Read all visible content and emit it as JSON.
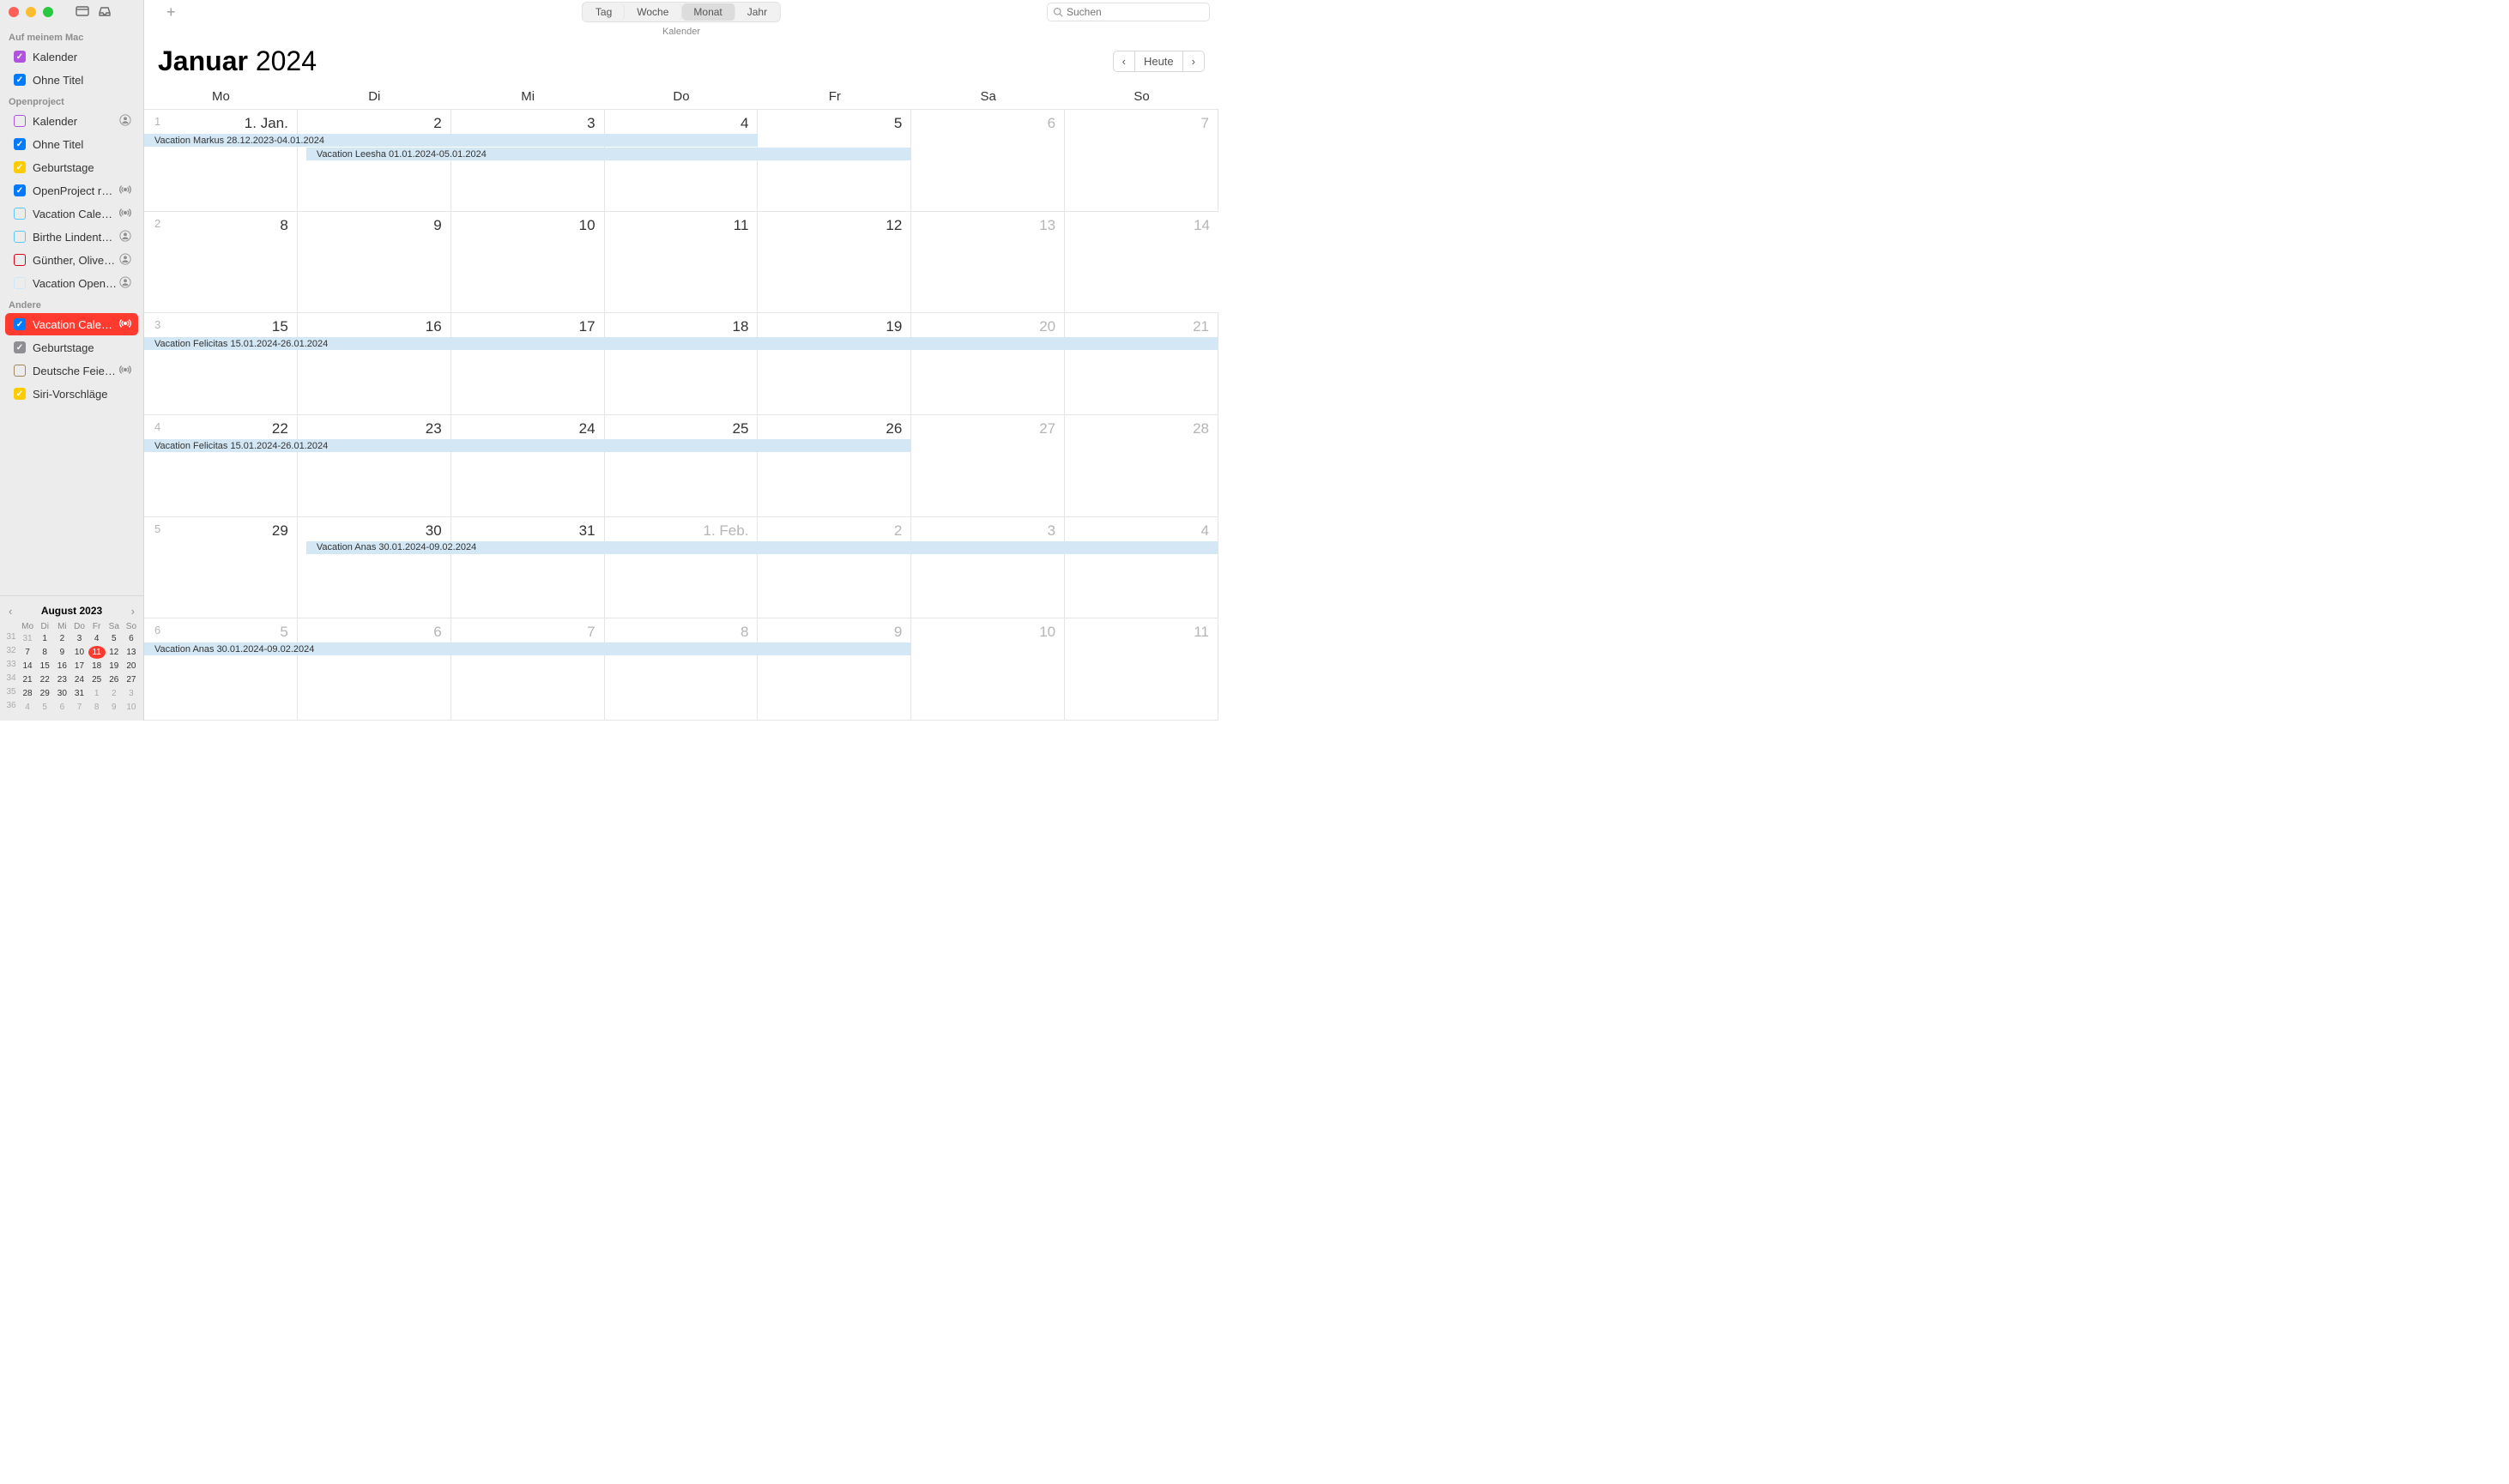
{
  "app_title": "Kalender",
  "views": {
    "day": "Tag",
    "week": "Woche",
    "month": "Monat",
    "year": "Jahr",
    "active": "month"
  },
  "search_placeholder": "Suchen",
  "today_button": "Heute",
  "month_title_month": "Januar",
  "month_title_year": "2024",
  "weekdays": [
    "Mo",
    "Di",
    "Mi",
    "Do",
    "Fr",
    "Sa",
    "So"
  ],
  "sidebar": {
    "sections": [
      {
        "title": "Auf meinem Mac",
        "items": [
          {
            "label": "Kalender",
            "color": "#af52de",
            "checked": true,
            "badge": null
          },
          {
            "label": "Ohne Titel",
            "color": "#007aff",
            "checked": true,
            "badge": null
          }
        ]
      },
      {
        "title": "Openproject",
        "items": [
          {
            "label": "Kalender",
            "color": "#af52de",
            "checked": false,
            "badge": "person"
          },
          {
            "label": "Ohne Titel",
            "color": "#007aff",
            "checked": true,
            "badge": null
          },
          {
            "label": "Geburtstage",
            "color": "#ffcc00",
            "checked": true,
            "badge": null
          },
          {
            "label": "OpenProject r…",
            "color": "#007aff",
            "checked": true,
            "badge": "broadcast"
          },
          {
            "label": "Vacation Cale…",
            "color": "#5ac8fa",
            "checked": false,
            "badge": "broadcast"
          },
          {
            "label": "Birthe Lindent…",
            "color": "#5ac8fa",
            "checked": false,
            "badge": "person",
            "faded": true
          },
          {
            "label": "Günther, Olive…",
            "color": "#d70015",
            "checked": false,
            "badge": "person",
            "solid": true
          },
          {
            "label": "Vacation Open…",
            "color": "#cce8f6",
            "checked": false,
            "badge": "person"
          }
        ]
      },
      {
        "title": "Andere",
        "items": [
          {
            "label": "Vacation Cale…",
            "color": "#007aff",
            "checked": true,
            "badge": "broadcast",
            "selected": true
          },
          {
            "label": "Geburtstage",
            "color": "#8e8e93",
            "checked": true,
            "badge": null
          },
          {
            "label": "Deutsche Feie…",
            "color": "#a2845e",
            "checked": false,
            "badge": "broadcast",
            "solid": true
          },
          {
            "label": "Siri-Vorschläge",
            "color": "#ffcc00",
            "checked": true,
            "badge": null
          }
        ]
      }
    ]
  },
  "mini_cal": {
    "title": "August 2023",
    "dow": [
      "Mo",
      "Di",
      "Mi",
      "Do",
      "Fr",
      "Sa",
      "So"
    ],
    "weeks": [
      {
        "wk": "31",
        "days": [
          "31",
          "1",
          "2",
          "3",
          "4",
          "5",
          "6"
        ],
        "dim": [
          0
        ]
      },
      {
        "wk": "32",
        "days": [
          "7",
          "8",
          "9",
          "10",
          "11",
          "12",
          "13"
        ],
        "today": 4
      },
      {
        "wk": "33",
        "days": [
          "14",
          "15",
          "16",
          "17",
          "18",
          "19",
          "20"
        ]
      },
      {
        "wk": "34",
        "days": [
          "21",
          "22",
          "23",
          "24",
          "25",
          "26",
          "27"
        ]
      },
      {
        "wk": "35",
        "days": [
          "28",
          "29",
          "30",
          "31",
          "1",
          "2",
          "3"
        ],
        "dim": [
          4,
          5,
          6
        ]
      },
      {
        "wk": "36",
        "days": [
          "4",
          "5",
          "6",
          "7",
          "8",
          "9",
          "10"
        ],
        "dim": [
          0,
          1,
          2,
          3,
          4,
          5,
          6
        ]
      }
    ]
  },
  "grid": {
    "week_nums": [
      "1",
      "2",
      "3",
      "4",
      "5",
      "6"
    ],
    "rows": [
      {
        "days": [
          {
            "label": "1. Jan."
          },
          {
            "label": "2"
          },
          {
            "label": "3"
          },
          {
            "label": "4"
          },
          {
            "label": "5"
          },
          {
            "label": "6",
            "dim": true
          },
          {
            "label": "7",
            "dim": true
          }
        ],
        "events": [
          {
            "text": "Vacation Markus 28.12.2023-04.01.2024",
            "start": 0,
            "end": 4,
            "row": 1
          },
          {
            "text": "Vacation Leesha 01.01.2024-05.01.2024",
            "start": 1,
            "end": 5,
            "row": 2,
            "indent": true
          }
        ]
      },
      {
        "days": [
          {
            "label": "8"
          },
          {
            "label": "9"
          },
          {
            "label": "10"
          },
          {
            "label": "11"
          },
          {
            "label": "12"
          },
          {
            "label": "13",
            "dim": true
          },
          {
            "label": "14",
            "dim": true
          }
        ],
        "events": []
      },
      {
        "days": [
          {
            "label": "15"
          },
          {
            "label": "16"
          },
          {
            "label": "17"
          },
          {
            "label": "18"
          },
          {
            "label": "19"
          },
          {
            "label": "20",
            "dim": true
          },
          {
            "label": "21",
            "dim": true
          }
        ],
        "events": [
          {
            "text": "Vacation Felicitas 15.01.2024-26.01.2024",
            "start": 0,
            "end": 7,
            "row": 1
          }
        ]
      },
      {
        "days": [
          {
            "label": "22"
          },
          {
            "label": "23"
          },
          {
            "label": "24"
          },
          {
            "label": "25"
          },
          {
            "label": "26"
          },
          {
            "label": "27",
            "dim": true
          },
          {
            "label": "28",
            "dim": true
          }
        ],
        "events": [
          {
            "text": "Vacation Felicitas 15.01.2024-26.01.2024",
            "start": 0,
            "end": 5,
            "row": 1
          }
        ]
      },
      {
        "days": [
          {
            "label": "29"
          },
          {
            "label": "30"
          },
          {
            "label": "31"
          },
          {
            "label": "1. Feb.",
            "dim": true
          },
          {
            "label": "2",
            "dim": true
          },
          {
            "label": "3",
            "dim": true
          },
          {
            "label": "4",
            "dim": true
          }
        ],
        "events": [
          {
            "text": "Vacation Anas 30.01.2024-09.02.2024",
            "start": 1,
            "end": 7,
            "row": 1,
            "indent": true
          }
        ]
      },
      {
        "days": [
          {
            "label": "5",
            "dim": true
          },
          {
            "label": "6",
            "dim": true
          },
          {
            "label": "7",
            "dim": true
          },
          {
            "label": "8",
            "dim": true
          },
          {
            "label": "9",
            "dim": true
          },
          {
            "label": "10",
            "dim": true
          },
          {
            "label": "11",
            "dim": true
          }
        ],
        "events": [
          {
            "text": "Vacation Anas 30.01.2024-09.02.2024",
            "start": 0,
            "end": 5,
            "row": 1
          }
        ]
      }
    ]
  }
}
